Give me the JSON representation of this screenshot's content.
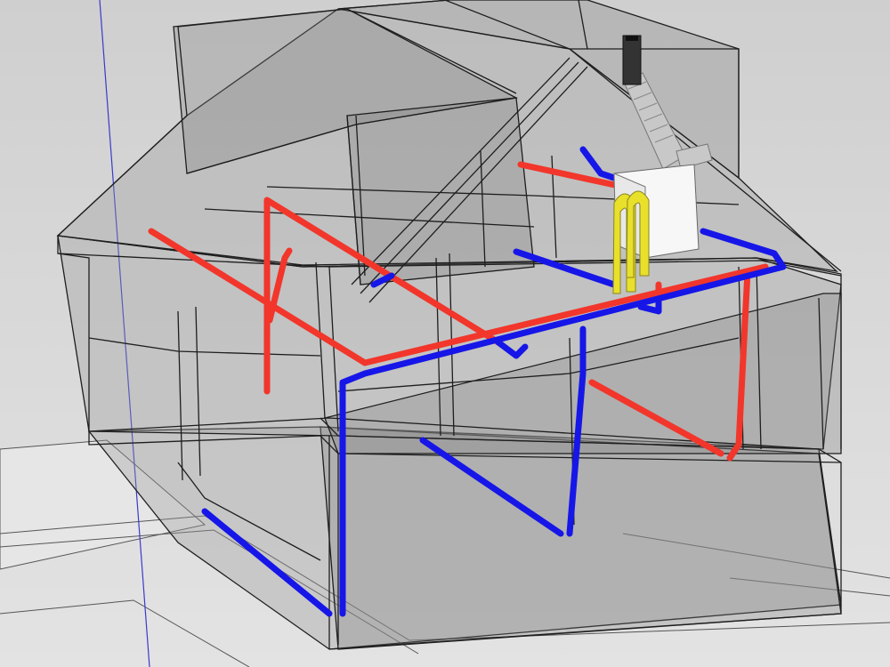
{
  "viewport": {
    "background_top": "#cfcfcf",
    "background_bottom": "#e3e3e3",
    "ground_fill": "#e6e6e6"
  },
  "model": {
    "edge_color": "#1e1e1e",
    "glass_fill": "#9a9a9a",
    "glass_fill_dark": "#7f7f7f",
    "axis_color": "#3a3acc"
  },
  "pipes": {
    "supply_color": "#f2362b",
    "return_color": "#1616e8",
    "flue_color": "#e8e02a",
    "duct_color": "#c8c8c8",
    "unit_color": "#f7f7f7"
  },
  "icons": {
    "heating_unit": "boiler-icon",
    "flue": "flue-duct-icon"
  }
}
